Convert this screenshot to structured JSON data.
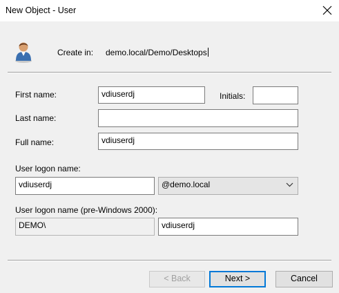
{
  "window": {
    "title": "New Object - User",
    "close_icon": "close-icon"
  },
  "header": {
    "icon": "user-icon",
    "create_in_label": "Create in:",
    "create_in_path": "demo.local/Demo/Desktops"
  },
  "form": {
    "first_name": {
      "label": "First name:",
      "value": "vdiuserdj"
    },
    "initials": {
      "label": "Initials:",
      "value": ""
    },
    "last_name": {
      "label": "Last name:",
      "value": ""
    },
    "full_name": {
      "label": "Full name:",
      "value": "vdiuserdj"
    },
    "logon_name": {
      "label": "User logon name:",
      "value": "vdiuserdj",
      "domain": "@demo.local"
    },
    "pre2000": {
      "label": "User logon name (pre-Windows 2000):",
      "domain": "DEMO\\",
      "value": "vdiuserdj"
    }
  },
  "buttons": {
    "back": "< Back",
    "next": "Next >",
    "cancel": "Cancel"
  },
  "colors": {
    "dialog_bg": "#f0f0f0",
    "default_button_border": "#0078d7"
  }
}
